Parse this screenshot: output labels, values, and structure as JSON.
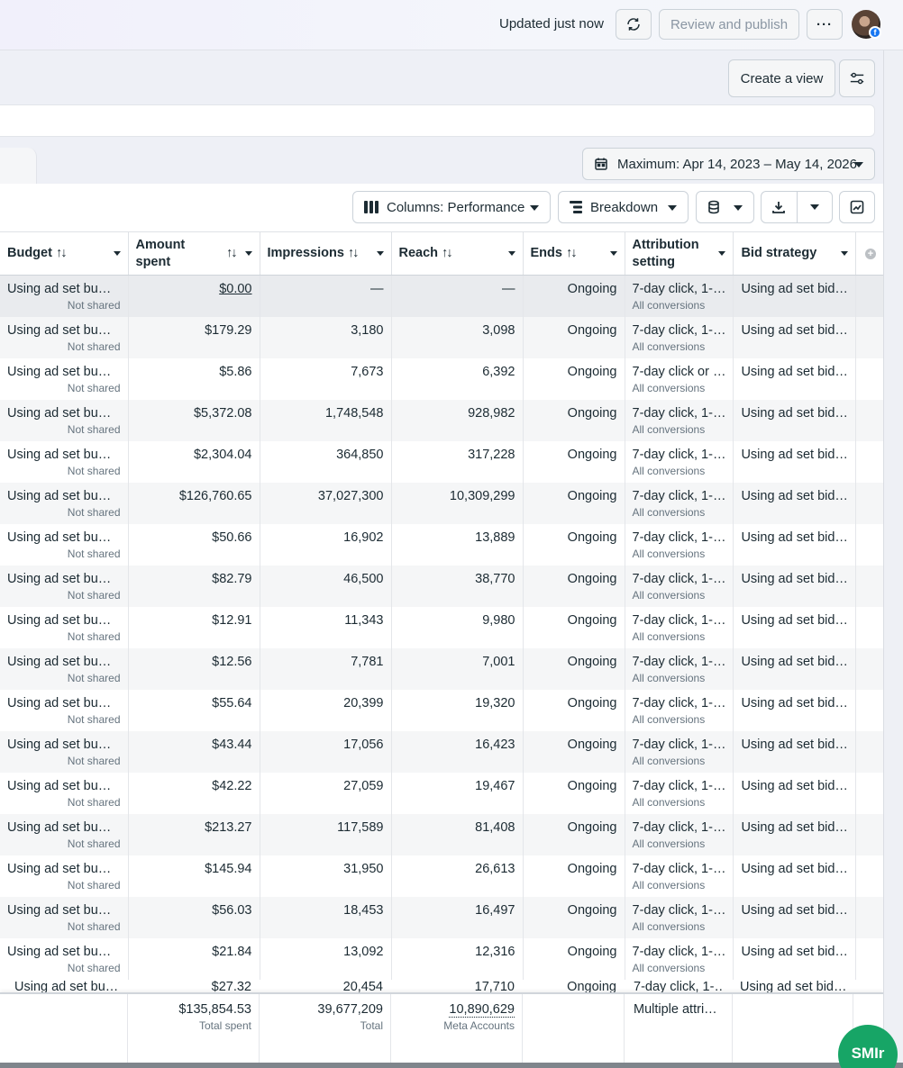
{
  "header": {
    "status_text": "Updated just now",
    "review_label": "Review and publish",
    "more_label": "···",
    "fb_badge": "f"
  },
  "view": {
    "create_view_label": "Create a view"
  },
  "date_range": {
    "label": "Maximum: Apr 14, 2023 – May 14, 2026"
  },
  "toolbar": {
    "columns_label": "Columns: Performance",
    "breakdown_label": "Breakdown"
  },
  "table": {
    "columns": [
      {
        "label": "Budget",
        "sort": "↑↓"
      },
      {
        "label": "Amount spent",
        "sort": "↑↓"
      },
      {
        "label": "Impressions",
        "sort": "↑↓"
      },
      {
        "label": "Reach",
        "sort": "↑↓"
      },
      {
        "label": "Ends",
        "sort": "↑↓"
      },
      {
        "label": "Attribution setting"
      },
      {
        "label": "Bid strategy"
      }
    ],
    "rows": [
      {
        "budget": "Using ad set bu…",
        "budget_sub": "Not shared",
        "spent": "$0.00",
        "impressions": "—",
        "reach": "—",
        "ends": "Ongoing",
        "attribution": "7-day click, 1-…",
        "attribution_sub": "All conversions",
        "bid": "Using ad set bid…"
      },
      {
        "budget": "Using ad set bu…",
        "budget_sub": "Not shared",
        "spent": "$179.29",
        "impressions": "3,180",
        "reach": "3,098",
        "ends": "Ongoing",
        "attribution": "7-day click, 1-…",
        "attribution_sub": "All conversions",
        "bid": "Using ad set bid…"
      },
      {
        "budget": "Using ad set bu…",
        "budget_sub": "Not shared",
        "spent": "$5.86",
        "impressions": "7,673",
        "reach": "6,392",
        "ends": "Ongoing",
        "attribution": "7-day click or …",
        "attribution_sub": "All conversions",
        "bid": "Using ad set bid…"
      },
      {
        "budget": "Using ad set bu…",
        "budget_sub": "Not shared",
        "spent": "$5,372.08",
        "impressions": "1,748,548",
        "reach": "928,982",
        "ends": "Ongoing",
        "attribution": "7-day click, 1-…",
        "attribution_sub": "All conversions",
        "bid": "Using ad set bid…"
      },
      {
        "budget": "Using ad set bu…",
        "budget_sub": "Not shared",
        "spent": "$2,304.04",
        "impressions": "364,850",
        "reach": "317,228",
        "ends": "Ongoing",
        "attribution": "7-day click, 1-…",
        "attribution_sub": "All conversions",
        "bid": "Using ad set bid…"
      },
      {
        "budget": "Using ad set bu…",
        "budget_sub": "Not shared",
        "spent": "$126,760.65",
        "impressions": "37,027,300",
        "reach": "10,309,299",
        "ends": "Ongoing",
        "attribution": "7-day click, 1-…",
        "attribution_sub": "All conversions",
        "bid": "Using ad set bid…"
      },
      {
        "budget": "Using ad set bu…",
        "budget_sub": "Not shared",
        "spent": "$50.66",
        "impressions": "16,902",
        "reach": "13,889",
        "ends": "Ongoing",
        "attribution": "7-day click, 1-…",
        "attribution_sub": "All conversions",
        "bid": "Using ad set bid…"
      },
      {
        "budget": "Using ad set bu…",
        "budget_sub": "Not shared",
        "spent": "$82.79",
        "impressions": "46,500",
        "reach": "38,770",
        "ends": "Ongoing",
        "attribution": "7-day click, 1-…",
        "attribution_sub": "All conversions",
        "bid": "Using ad set bid…"
      },
      {
        "budget": "Using ad set bu…",
        "budget_sub": "Not shared",
        "spent": "$12.91",
        "impressions": "11,343",
        "reach": "9,980",
        "ends": "Ongoing",
        "attribution": "7-day click, 1-…",
        "attribution_sub": "All conversions",
        "bid": "Using ad set bid…"
      },
      {
        "budget": "Using ad set bu…",
        "budget_sub": "Not shared",
        "spent": "$12.56",
        "impressions": "7,781",
        "reach": "7,001",
        "ends": "Ongoing",
        "attribution": "7-day click, 1-…",
        "attribution_sub": "All conversions",
        "bid": "Using ad set bid…"
      },
      {
        "budget": "Using ad set bu…",
        "budget_sub": "Not shared",
        "spent": "$55.64",
        "impressions": "20,399",
        "reach": "19,320",
        "ends": "Ongoing",
        "attribution": "7-day click, 1-…",
        "attribution_sub": "All conversions",
        "bid": "Using ad set bid…"
      },
      {
        "budget": "Using ad set bu…",
        "budget_sub": "Not shared",
        "spent": "$43.44",
        "impressions": "17,056",
        "reach": "16,423",
        "ends": "Ongoing",
        "attribution": "7-day click, 1-…",
        "attribution_sub": "All conversions",
        "bid": "Using ad set bid…"
      },
      {
        "budget": "Using ad set bu…",
        "budget_sub": "Not shared",
        "spent": "$42.22",
        "impressions": "27,059",
        "reach": "19,467",
        "ends": "Ongoing",
        "attribution": "7-day click, 1-…",
        "attribution_sub": "All conversions",
        "bid": "Using ad set bid…"
      },
      {
        "budget": "Using ad set bu…",
        "budget_sub": "Not shared",
        "spent": "$213.27",
        "impressions": "117,589",
        "reach": "81,408",
        "ends": "Ongoing",
        "attribution": "7-day click, 1-…",
        "attribution_sub": "All conversions",
        "bid": "Using ad set bid…"
      },
      {
        "budget": "Using ad set bu…",
        "budget_sub": "Not shared",
        "spent": "$145.94",
        "impressions": "31,950",
        "reach": "26,613",
        "ends": "Ongoing",
        "attribution": "7-day click, 1-…",
        "attribution_sub": "All conversions",
        "bid": "Using ad set bid…"
      },
      {
        "budget": "Using ad set bu…",
        "budget_sub": "Not shared",
        "spent": "$56.03",
        "impressions": "18,453",
        "reach": "16,497",
        "ends": "Ongoing",
        "attribution": "7-day click, 1-…",
        "attribution_sub": "All conversions",
        "bid": "Using ad set bid…"
      },
      {
        "budget": "Using ad set bu…",
        "budget_sub": "Not shared",
        "spent": "$21.84",
        "impressions": "13,092",
        "reach": "12,316",
        "ends": "Ongoing",
        "attribution": "7-day click, 1-…",
        "attribution_sub": "All conversions",
        "bid": "Using ad set bid…"
      }
    ],
    "partial_row": {
      "budget": "Using ad set bu…",
      "spent": "$27.32",
      "impressions": "20,454",
      "reach": "17,710",
      "ends": "Ongoing",
      "attribution": "7-day click, 1-…",
      "bid": "Using ad set bid…"
    }
  },
  "totals": {
    "spent": "$135,854.53",
    "spent_label": "Total spent",
    "impressions": "39,677,209",
    "impressions_label": "Total",
    "reach": "10,890,629",
    "reach_label": "Meta Accounts",
    "attribution": "Multiple attri…"
  },
  "widget": {
    "label": "SMIr"
  }
}
